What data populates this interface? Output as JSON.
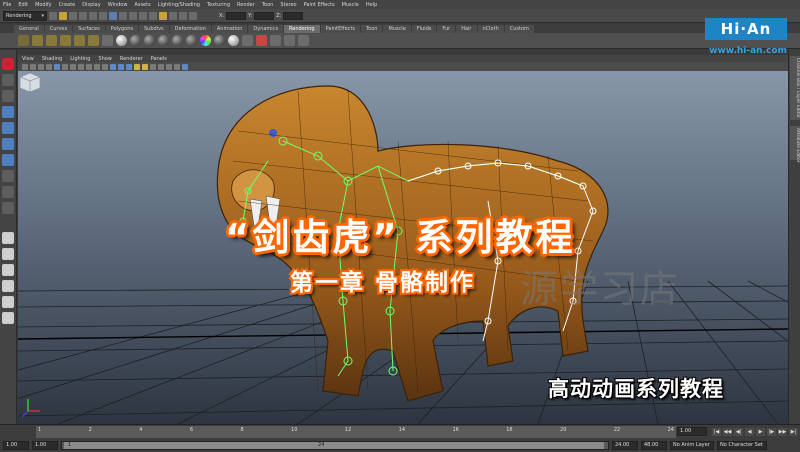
{
  "menubar": [
    "File",
    "Edit",
    "Modify",
    "Create",
    "Display",
    "Window",
    "Assets",
    "Lighting/Shading",
    "Texturing",
    "Render",
    "Toon",
    "Stereo",
    "Paint Effects",
    "Muscle",
    "Help"
  ],
  "status": {
    "mode": "Rendering",
    "fields": [
      "X:",
      "Y:",
      "Z:"
    ]
  },
  "shelf_tabs": [
    "General",
    "Curves",
    "Surfaces",
    "Polygons",
    "Subdivs",
    "Deformation",
    "Animation",
    "Dynamics",
    "Rendering",
    "PaintEffects",
    "Toon",
    "Muscle",
    "Fluids",
    "Fur",
    "Hair",
    "nCloth",
    "Custom"
  ],
  "active_shelf_tab": "Rendering",
  "logo": {
    "text": "Hi·An",
    "url": "www.hi-an.com",
    "color": "#1f84c6"
  },
  "viewport_menu": [
    "View",
    "Shading",
    "Lighting",
    "Show",
    "Renderer",
    "Panels"
  ],
  "right_tabs": [
    "Channel Box / Layer Editor",
    "Attribute Editor"
  ],
  "overlay": {
    "title": "“剑齿虎” 系列教程",
    "subtitle": "第一章   骨骼制作",
    "watermark": "源学习店",
    "caption": "高动动画系列教程",
    "accent": "#ff6600"
  },
  "timeline": {
    "ticks": [
      "1",
      "2",
      "4",
      "6",
      "8",
      "10",
      "12",
      "14",
      "16",
      "18",
      "20",
      "22",
      "24"
    ],
    "current_frame": "1.00",
    "controls": [
      "|◀",
      "◀◀",
      "◀|",
      "◀",
      "▶",
      "|▶",
      "▶▶",
      "▶|"
    ]
  },
  "range": {
    "start": "1.00",
    "start2": "1.00",
    "handle_label": "1",
    "handle_end": "24",
    "end": "24.00",
    "end2": "48.00",
    "anim_layer": "No Anim Layer",
    "char_set": "No Character Set"
  }
}
